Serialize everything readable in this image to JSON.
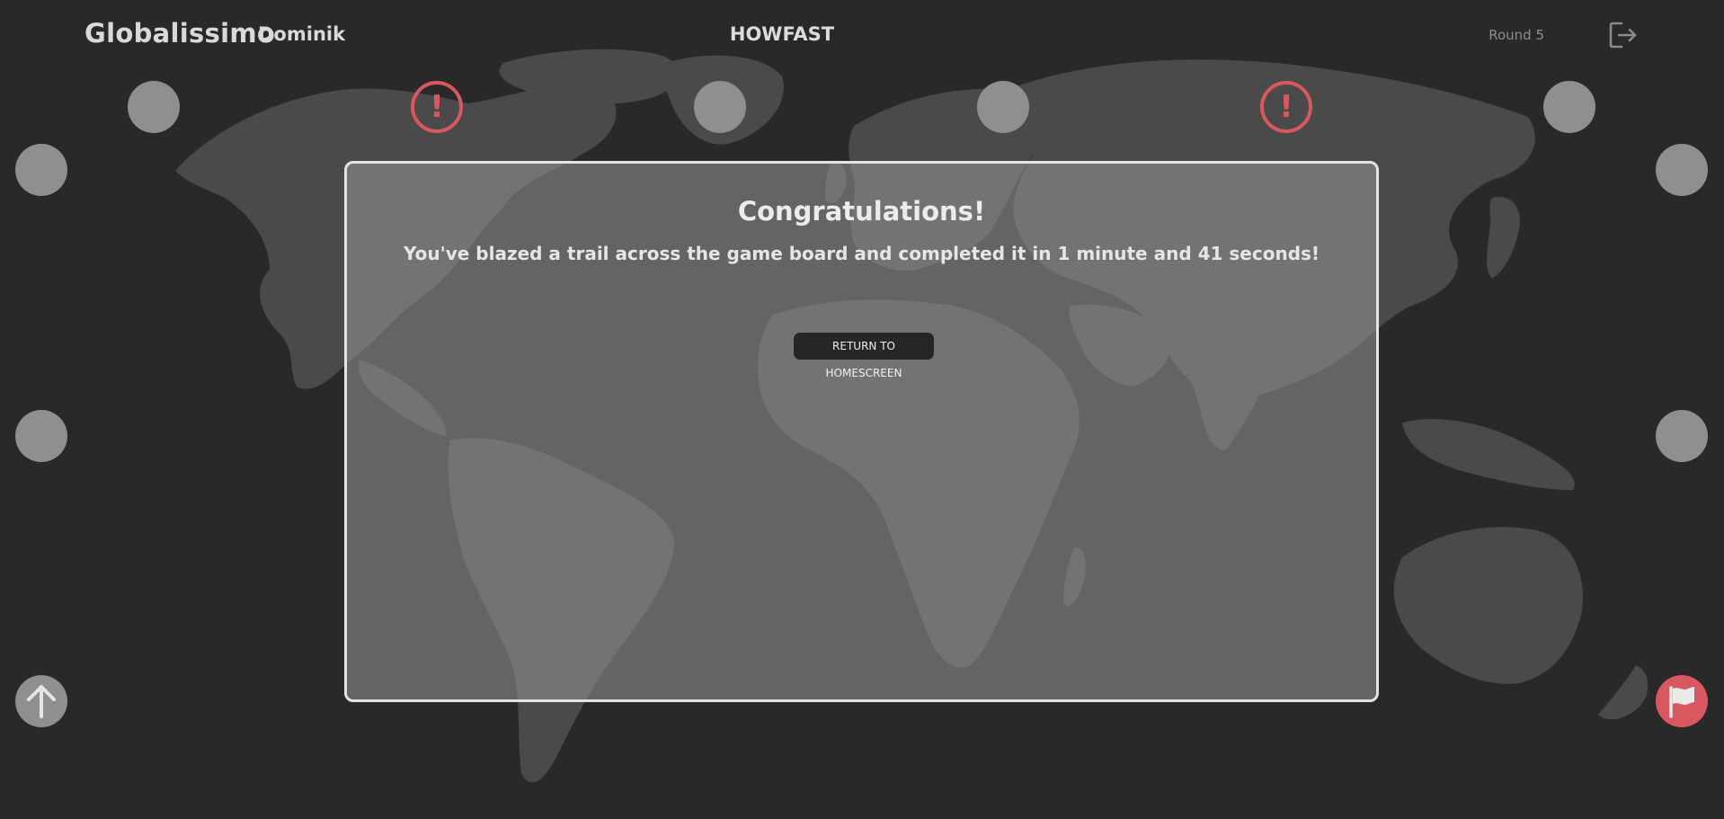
{
  "header": {
    "app_title": "Globalissimo",
    "player_name": "Dominik",
    "game_mode": "HOWFAST",
    "round_label": "Round 5",
    "logout_icon": "logout-icon"
  },
  "board": {
    "node_color": "#8f8f8f",
    "alert_color": "#d9585f",
    "background_color": "#292929",
    "map_color": "#4a4a4a",
    "alert_symbol": "!",
    "nodes": [
      {
        "state": "empty"
      },
      {
        "state": "alert"
      },
      {
        "state": "empty"
      },
      {
        "state": "empty"
      },
      {
        "state": "alert"
      },
      {
        "state": "empty"
      },
      {
        "state": "empty"
      },
      {
        "state": "empty"
      },
      {
        "state": "empty"
      },
      {
        "state": "empty"
      },
      {
        "state": "start"
      },
      {
        "state": "finish"
      }
    ]
  },
  "result": {
    "heading": "Congratulations!",
    "message": "You've blazed a trail across the game board and completed it in 1 minute and 41 seconds!",
    "return_button": "RETURN TO HOMESCREEN"
  }
}
